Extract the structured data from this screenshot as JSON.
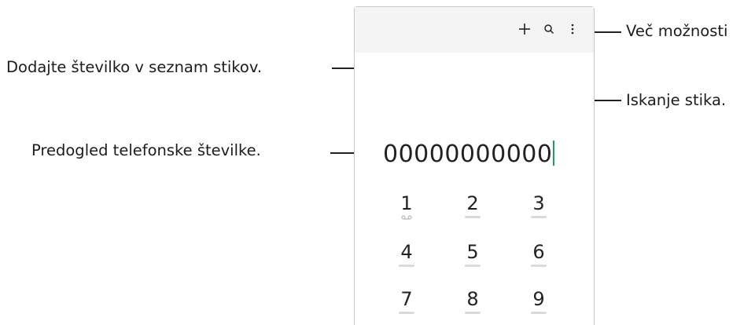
{
  "callouts": {
    "more_options": "Več možnosti",
    "add_number": "Dodajte številko v seznam stikov.",
    "search_contacts": "Iskanje stika.",
    "number_preview": "Predogled telefonske številke."
  },
  "phone": {
    "toolbar": {
      "icons": [
        "add-icon",
        "search-icon",
        "more-options-icon"
      ]
    },
    "entered_number": "00000000000",
    "keypad": [
      {
        "digit": "1",
        "sub": "voicemail-icon"
      },
      {
        "digit": "2",
        "sub": "ABC"
      },
      {
        "digit": "3",
        "sub": "DEF"
      },
      {
        "digit": "4",
        "sub": "GHI"
      },
      {
        "digit": "5",
        "sub": "JKL"
      },
      {
        "digit": "6",
        "sub": "MNO"
      },
      {
        "digit": "7",
        "sub": "PQRS"
      },
      {
        "digit": "8",
        "sub": "TUV"
      },
      {
        "digit": "9",
        "sub": "WXYZ"
      }
    ]
  },
  "colors": {
    "cursor": "#1e9d6b",
    "toolbar_bg": "#f4f4f4",
    "frame": "#c8c8c8"
  }
}
